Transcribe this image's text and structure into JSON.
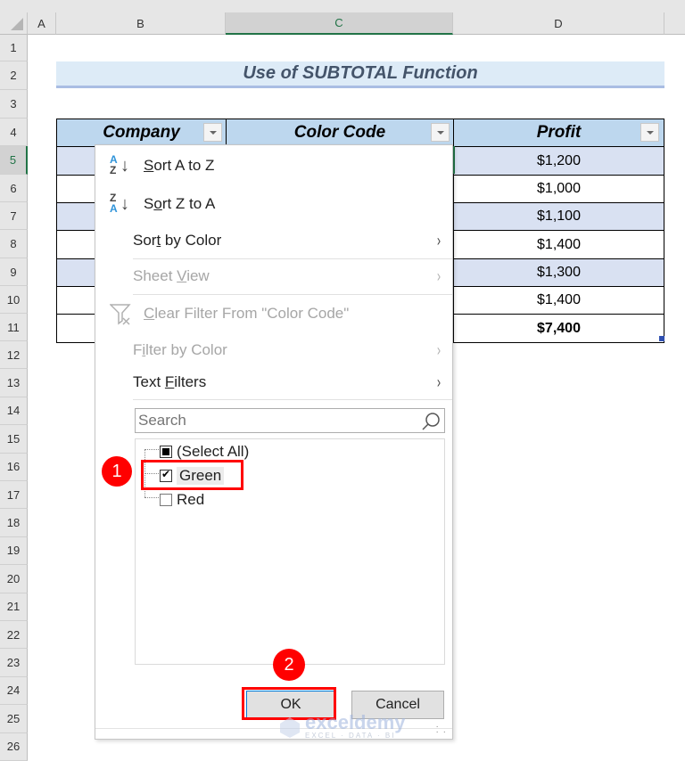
{
  "sheet": {
    "columns": [
      "A",
      "B",
      "C",
      "D"
    ],
    "selected_column": "C",
    "rows": [
      "1",
      "2",
      "3",
      "4",
      "5",
      "6",
      "7",
      "8",
      "9",
      "10",
      "11",
      "12",
      "13",
      "14",
      "15",
      "16",
      "17",
      "18",
      "19",
      "20",
      "21",
      "22",
      "23",
      "24",
      "25",
      "26"
    ],
    "selected_row": "5",
    "title": "Use of SUBTOTAL Function",
    "table": {
      "headers": [
        "Company",
        "Color Code",
        "Profit"
      ],
      "profit_values": [
        "$1,200",
        "$1,000",
        "$1,100",
        "$1,400",
        "$1,300",
        "$1,400",
        "$7,400"
      ]
    }
  },
  "filter_menu": {
    "sort_az": {
      "pre": "",
      "u": "S",
      "post": "ort A to Z",
      "icon_top": "A",
      "icon_bottom": "Z"
    },
    "sort_za": {
      "pre": "S",
      "u": "o",
      "post": "rt Z to A",
      "icon_top": "Z",
      "icon_bottom": "A"
    },
    "sort_by_color": {
      "pre": "Sor",
      "u": "t",
      "post": " by Color"
    },
    "sheet_view": {
      "pre": "Sheet ",
      "u": "V",
      "post": "iew"
    },
    "clear_filter": {
      "pre": "",
      "u": "C",
      "post": "lear Filter From \"Color Code\""
    },
    "filter_by_color": {
      "pre": "F",
      "u": "i",
      "post": "lter by Color"
    },
    "text_filters": {
      "pre": "Text ",
      "u": "F",
      "post": "ilters"
    },
    "search_placeholder": "Search",
    "items": [
      {
        "label": "(Select All)",
        "state": "partial"
      },
      {
        "label": "Green",
        "state": "checked"
      },
      {
        "label": "Red",
        "state": "unchecked"
      }
    ],
    "ok_label": "OK",
    "cancel_label": "Cancel"
  },
  "annotations": {
    "badge1": "1",
    "badge2": "2",
    "highlight_color": "#ff0000"
  },
  "watermark": {
    "name": "exceldemy",
    "tagline": "EXCEL · DATA · BI"
  },
  "chevron": "›"
}
